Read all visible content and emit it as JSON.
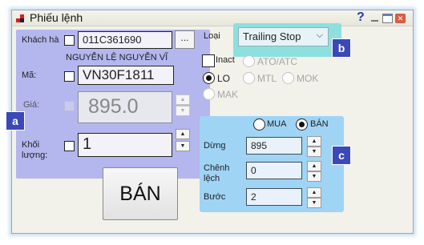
{
  "window": {
    "title": "Phiếu lệnh",
    "help_glyph": "?"
  },
  "order": {
    "account_label": "Khách hà",
    "account_value": "011C361690",
    "account_browse_label": "...",
    "customer_name": "NGUYỄN LỆ NGUYỄN VĨ",
    "symbol_label": "Mã:",
    "symbol_value": "VN30F1811",
    "price_label": "Giá:",
    "price_value": "895.0",
    "quantity_label": "Khối lượng:",
    "quantity_value": "1",
    "submit_label": "BÁN"
  },
  "order_type": {
    "label": "Loại",
    "selected": "Trailing Stop",
    "inact_label": "Inact",
    "options": {
      "ato_atc": "ATO/ATC",
      "lo": "LO",
      "mtl": "MTL",
      "mok": "MOK",
      "mak": "MAK"
    },
    "selected_option": "LO"
  },
  "trailing": {
    "side_buy_label": "MUA",
    "side_sell_label": "BÁN",
    "selected_side": "BÁN",
    "stop_label": "Dừng",
    "stop_value": "895",
    "diff_label": "Chênh lệch",
    "diff_value": "0",
    "step_label": "Bước",
    "step_value": "2"
  },
  "callouts": {
    "a": "a",
    "b": "b",
    "c": "c"
  },
  "colors": {
    "left_panel": "#b4b6ee",
    "type_highlight": "#8de0de",
    "trailing_panel": "#9fd4f5",
    "callout_tag": "#3a48b8"
  }
}
